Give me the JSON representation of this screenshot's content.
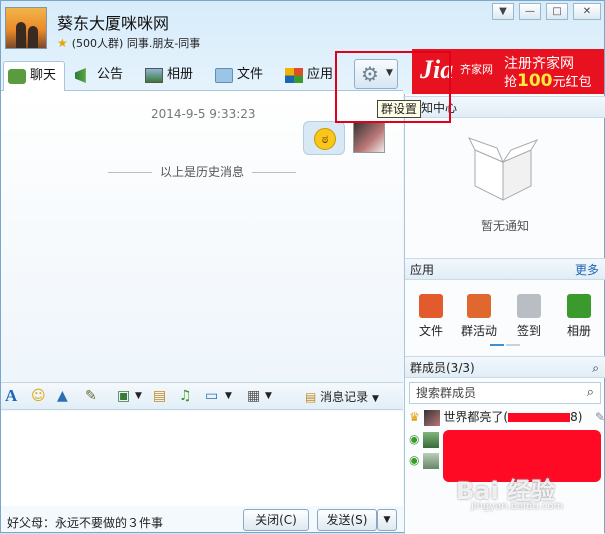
{
  "header": {
    "group_name": "葵东大厦咪咪网",
    "group_sub": "(500人群) 同事.朋友-同事",
    "window_controls": [
      "▼",
      "—",
      "□",
      "✕"
    ]
  },
  "tabs": [
    {
      "label": "聊天"
    },
    {
      "label": "公告"
    },
    {
      "label": "相册"
    },
    {
      "label": "文件"
    },
    {
      "label": "应用"
    }
  ],
  "settings": {
    "tooltip": "群设置",
    "overflow_text": "知中心"
  },
  "ad": {
    "logo": "Jia",
    "logo_sub": "齐家网",
    "line1": "注册齐家网",
    "line2_pre": "抢",
    "line2_amount": "100",
    "line2_post": "元红包"
  },
  "chat": {
    "timestamp": "2014-9-5 9:33:23",
    "history_divider": "以上是历史消息"
  },
  "toolbar": {
    "message_record": "消息记录"
  },
  "footer": {
    "tip": "好父母：永远不要做的３件事",
    "close_button": "关闭(C)",
    "send_button": "发送(S)"
  },
  "right_panel": {
    "no_notification": "暂无通知",
    "apps_title": "应用",
    "apps_more": "更多",
    "apps": [
      {
        "label": "文件",
        "color": "#e35b2c"
      },
      {
        "label": "群活动",
        "color": "#e0672d"
      },
      {
        "label": "签到",
        "color": "#b9bec4"
      },
      {
        "label": "相册",
        "color": "#3a9b2c"
      }
    ],
    "members_title": "群成员(3/3)",
    "search_placeholder": "搜索群成员",
    "members": [
      {
        "name": "世界都亮了(",
        "suffix": "8)"
      }
    ]
  },
  "colors": {
    "accent": "#1d64b5",
    "ad_red": "#e8111f",
    "highlight": "#e0001a"
  },
  "watermark": {
    "main": "Bai 经验",
    "sub": "jingyan.baidu.com"
  }
}
